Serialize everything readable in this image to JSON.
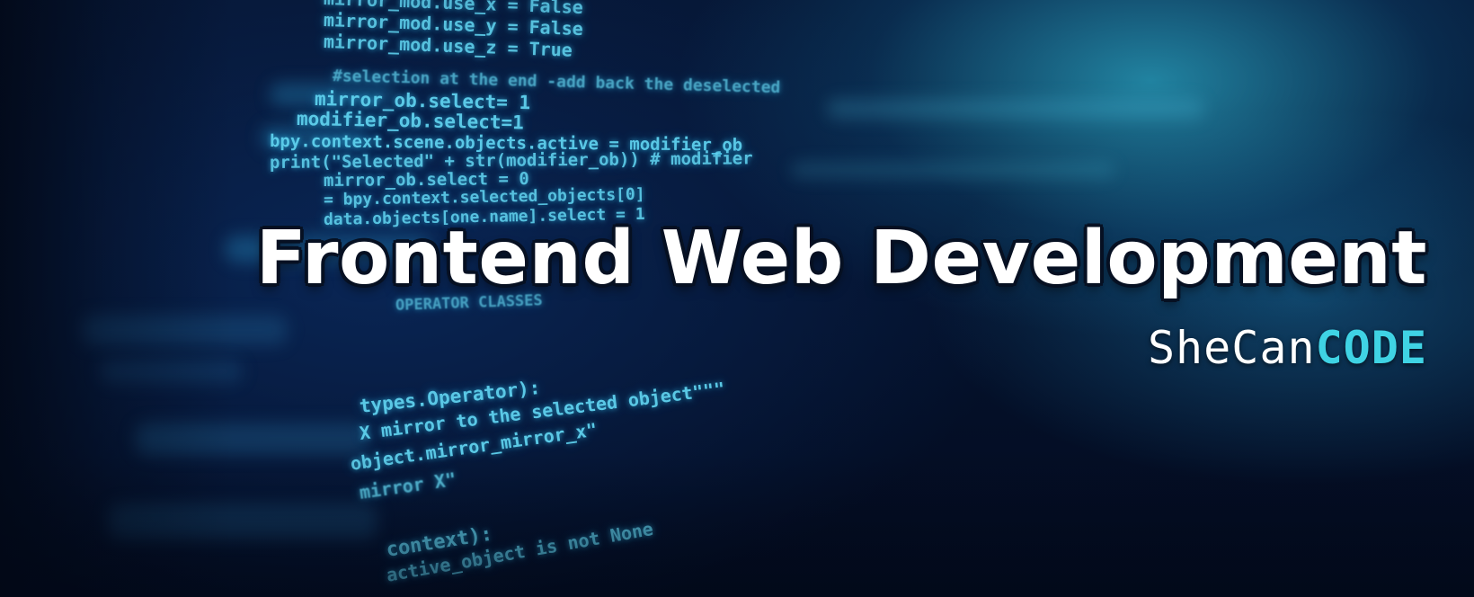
{
  "banner": {
    "title": "Frontend Web Development",
    "brand": {
      "prefix": "SheCan",
      "suffix": "CODE"
    },
    "colors": {
      "title": "#ffffff",
      "title_outline": "#061022",
      "brand_prefix": "#ffffff",
      "brand_suffix": "#3fd3e4",
      "code_text": "#5fd2ef",
      "background": "#04102a"
    }
  },
  "code_lines": [
    "mirror_mod.use_x = False",
    "mirror_mod.use_y = False",
    "mirror_mod.use_z = True",
    "#selection at the end -add back the deselected",
    "mirror_ob.select= 1",
    "modifier_ob.select=1",
    "bpy.context.scene.objects.active = modifier_ob",
    "print(\"Selected\" + str(modifier_ob)) # modifier",
    "mirror_ob.select = 0",
    "= bpy.context.selected_objects[0]",
    "data.objects[one.name].select = 1",
    "OPERATOR CLASSES",
    "types.Operator):",
    "X mirror to the selected object\"\"\"",
    "object.mirror_mirror_x\"",
    "mirror X\"",
    "context):",
    "active_object is not None"
  ]
}
